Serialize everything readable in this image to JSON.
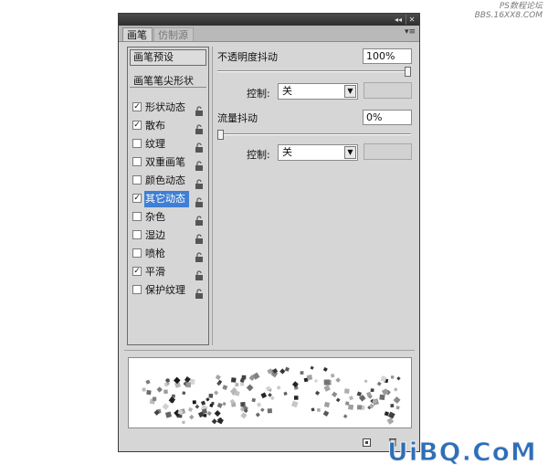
{
  "watermark": {
    "top_line1": "PS数程论坛",
    "top_line2": "BBS.16XX8.COM",
    "bottom": "UiBQ.CoM"
  },
  "titlebar": {
    "collapse_label": "◂◂",
    "close_label": "✕"
  },
  "tabs": [
    {
      "label": "画笔",
      "active": true
    },
    {
      "label": "仿制源",
      "active": false
    }
  ],
  "tab_menu_icon": "panel-menu-icon",
  "left": {
    "preset_button": "画笔预设",
    "header": "画笔笔尖形状",
    "items": [
      {
        "label": "形状动态",
        "checked": true,
        "selected": false
      },
      {
        "label": "散布",
        "checked": true,
        "selected": false
      },
      {
        "label": "纹理",
        "checked": false,
        "selected": false
      },
      {
        "label": "双重画笔",
        "checked": false,
        "selected": false
      },
      {
        "label": "颜色动态",
        "checked": false,
        "selected": false
      },
      {
        "label": "其它动态",
        "checked": true,
        "selected": true
      },
      {
        "label": "杂色",
        "checked": false,
        "selected": false
      },
      {
        "label": "湿边",
        "checked": false,
        "selected": false
      },
      {
        "label": "喷枪",
        "checked": false,
        "selected": false
      },
      {
        "label": "平滑",
        "checked": true,
        "selected": false
      },
      {
        "label": "保护纹理",
        "checked": false,
        "selected": false
      }
    ]
  },
  "right": {
    "opacity_jitter": {
      "label": "不透明度抖动",
      "value": "100%",
      "slider_fraction": 1.0,
      "control_label": "控制:",
      "control_value": "关"
    },
    "flow_jitter": {
      "label": "流量抖动",
      "value": "0%",
      "slider_fraction": 0.0,
      "control_label": "控制:",
      "control_value": "关"
    }
  },
  "colors": {
    "panel_bg": "#d6d6d6",
    "selection": "#3f7fd4",
    "watermark_blue": "#2d6fb8"
  }
}
